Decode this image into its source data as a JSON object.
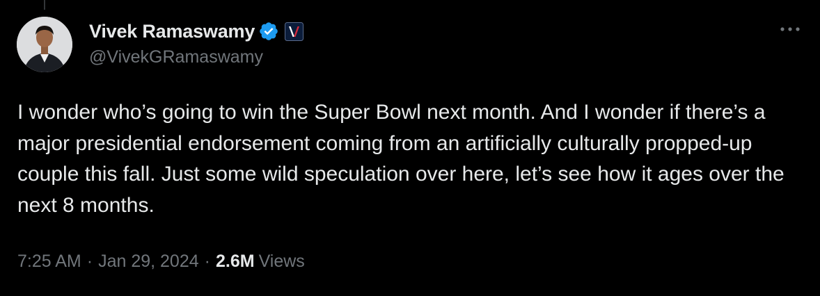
{
  "tweet": {
    "author": {
      "display_name": "Vivek Ramaswamy",
      "handle": "@VivekGRamaswamy",
      "avatar_icon": "profile-photo",
      "verified_icon": "verified-badge-icon",
      "verified_color": "#1d9bf0",
      "affiliate_icon": "affiliate-v-logo-icon"
    },
    "more_icon": "more-options-icon",
    "text": "I wonder who’s going to win the Super Bowl next month. And I wonder if there’s a major presidential endorsement coming from an artificially culturally propped-up couple this fall. Just some wild speculation over here, let’s see how it ages over the next 8 months.",
    "time": "7:25 AM",
    "separator": "·",
    "date": "Jan 29, 2024",
    "views_count": "2.6M",
    "views_label": "Views"
  },
  "colors": {
    "background": "#000000",
    "primary_text": "#e7e9ea",
    "secondary_text": "#71767b",
    "accent_blue": "#1d9bf0"
  }
}
